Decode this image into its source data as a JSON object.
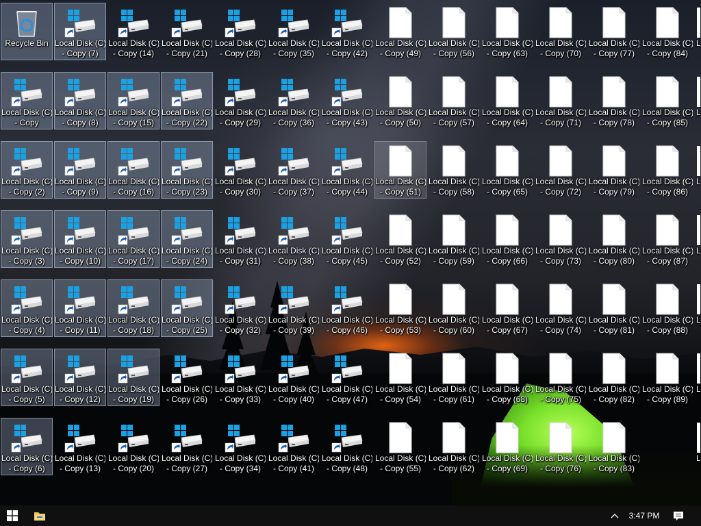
{
  "desktop": {
    "recycle_bin_label": "Recycle Bin",
    "icons": [
      {
        "l1": "Local Disk (C)",
        "l2": "- Copy",
        "type": "disk",
        "state": "sel"
      },
      {
        "l1": "Local Disk (C)",
        "l2": "- Copy (2)",
        "type": "disk",
        "state": "sel"
      },
      {
        "l1": "Local Disk (C)",
        "l2": "- Copy (3)",
        "type": "disk",
        "state": "sel"
      },
      {
        "l1": "Local Disk (C)",
        "l2": "- Copy (4)",
        "type": "disk",
        "state": "sel"
      },
      {
        "l1": "Local Disk (C)",
        "l2": "- Copy (5)",
        "type": "disk",
        "state": "sel"
      },
      {
        "l1": "Local Disk (C)",
        "l2": "- Copy (6)",
        "type": "disk",
        "state": "sel"
      },
      {
        "l1": "Local Disk (C)",
        "l2": "- Copy (7)",
        "type": "disk",
        "state": "sel"
      },
      {
        "l1": "Local Disk (C)",
        "l2": "- Copy (8)",
        "type": "disk",
        "state": "sel"
      },
      {
        "l1": "Local Disk (C)",
        "l2": "- Copy (9)",
        "type": "disk",
        "state": "sel"
      },
      {
        "l1": "Local Disk (C)",
        "l2": "- Copy (10)",
        "type": "disk",
        "state": "sel"
      },
      {
        "l1": "Local Disk (C)",
        "l2": "- Copy (11)",
        "type": "disk",
        "state": "sel"
      },
      {
        "l1": "Local Disk (C)",
        "l2": "- Copy (12)",
        "type": "disk",
        "state": "sel"
      },
      {
        "l1": "Local Disk (C)",
        "l2": "- Copy (13)",
        "type": "disk",
        "state": ""
      },
      {
        "l1": "Local Disk (C)",
        "l2": "- Copy (14)",
        "type": "disk",
        "state": ""
      },
      {
        "l1": "Local Disk (C)",
        "l2": "- Copy (15)",
        "type": "disk",
        "state": "sel"
      },
      {
        "l1": "Local Disk (C)",
        "l2": "- Copy (16)",
        "type": "disk",
        "state": "sel"
      },
      {
        "l1": "Local Disk (C)",
        "l2": "- Copy (17)",
        "type": "disk",
        "state": "sel"
      },
      {
        "l1": "Local Disk (C)",
        "l2": "- Copy (18)",
        "type": "disk",
        "state": "sel"
      },
      {
        "l1": "Local Disk (C)",
        "l2": "- Copy (19)",
        "type": "disk",
        "state": "sel"
      },
      {
        "l1": "Local Disk (C)",
        "l2": "- Copy (20)",
        "type": "disk",
        "state": ""
      },
      {
        "l1": "Local Disk (C)",
        "l2": "- Copy (21)",
        "type": "disk",
        "state": ""
      },
      {
        "l1": "Local Disk (C)",
        "l2": "- Copy (22)",
        "type": "disk",
        "state": "sel"
      },
      {
        "l1": "Local Disk (C)",
        "l2": "- Copy (23)",
        "type": "disk",
        "state": "sel"
      },
      {
        "l1": "Local Disk (C)",
        "l2": "- Copy (24)",
        "type": "disk",
        "state": "sel"
      },
      {
        "l1": "Local Disk (C)",
        "l2": "- Copy (25)",
        "type": "disk",
        "state": "sel"
      },
      {
        "l1": "Local Disk (C)",
        "l2": "- Copy (26)",
        "type": "disk",
        "state": ""
      },
      {
        "l1": "Local Disk (C)",
        "l2": "- Copy (27)",
        "type": "disk",
        "state": ""
      },
      {
        "l1": "Local Disk (C)",
        "l2": "- Copy (28)",
        "type": "disk",
        "state": ""
      },
      {
        "l1": "Local Disk (C)",
        "l2": "- Copy (29)",
        "type": "disk",
        "state": ""
      },
      {
        "l1": "Local Disk (C)",
        "l2": "- Copy (30)",
        "type": "disk",
        "state": ""
      },
      {
        "l1": "Local Disk (C)",
        "l2": "- Copy (31)",
        "type": "disk",
        "state": ""
      },
      {
        "l1": "Local Disk (C)",
        "l2": "- Copy (32)",
        "type": "disk",
        "state": ""
      },
      {
        "l1": "Local Disk (C)",
        "l2": "- Copy (33)",
        "type": "disk",
        "state": ""
      },
      {
        "l1": "Local Disk (C)",
        "l2": "- Copy (34)",
        "type": "disk",
        "state": ""
      },
      {
        "l1": "Local Disk (C)",
        "l2": "- Copy (35)",
        "type": "disk",
        "state": ""
      },
      {
        "l1": "Local Disk (C)",
        "l2": "- Copy (36)",
        "type": "disk",
        "state": ""
      },
      {
        "l1": "Local Disk (C)",
        "l2": "- Copy (37)",
        "type": "disk",
        "state": ""
      },
      {
        "l1": "Local Disk (C)",
        "l2": "- Copy (38)",
        "type": "disk",
        "state": ""
      },
      {
        "l1": "Local Disk (C)",
        "l2": "- Copy (39)",
        "type": "disk",
        "state": ""
      },
      {
        "l1": "Local Disk (C)",
        "l2": "- Copy (40)",
        "type": "disk",
        "state": ""
      },
      {
        "l1": "Local Disk (C)",
        "l2": "- Copy (41)",
        "type": "disk",
        "state": ""
      },
      {
        "l1": "Local Disk (C)",
        "l2": "- Copy (42)",
        "type": "disk",
        "state": ""
      },
      {
        "l1": "Local Disk (C)",
        "l2": "- Copy (43)",
        "type": "disk",
        "state": ""
      },
      {
        "l1": "Local Disk (C)",
        "l2": "- Copy (44)",
        "type": "disk",
        "state": ""
      },
      {
        "l1": "Local Disk (C)",
        "l2": "- Copy (45)",
        "type": "disk",
        "state": ""
      },
      {
        "l1": "Local Disk (C)",
        "l2": "- Copy (46)",
        "type": "disk",
        "state": ""
      },
      {
        "l1": "Local Disk (C)",
        "l2": "- Copy (47)",
        "type": "disk",
        "state": ""
      },
      {
        "l1": "Local Disk (C)",
        "l2": "- Copy (48)",
        "type": "disk",
        "state": ""
      },
      {
        "l1": "Local Disk (C)",
        "l2": "- Copy (49)",
        "type": "file",
        "state": ""
      },
      {
        "l1": "Local Disk (C)",
        "l2": "- Copy (50)",
        "type": "file",
        "state": ""
      },
      {
        "l1": "Local Disk (C)",
        "l2": "- Copy (51)",
        "type": "file",
        "state": "hov"
      },
      {
        "l1": "Local Disk (C)",
        "l2": "- Copy (52)",
        "type": "file",
        "state": ""
      },
      {
        "l1": "Local Disk (C)",
        "l2": "- Copy (53)",
        "type": "file",
        "state": ""
      },
      {
        "l1": "Local Disk (C)",
        "l2": "- Copy (54)",
        "type": "file",
        "state": ""
      },
      {
        "l1": "Local Disk (C)",
        "l2": "- Copy (55)",
        "type": "file",
        "state": ""
      },
      {
        "l1": "Local Disk (C)",
        "l2": "- Copy (56)",
        "type": "file",
        "state": ""
      },
      {
        "l1": "Local Disk (C)",
        "l2": "- Copy (57)",
        "type": "file",
        "state": ""
      },
      {
        "l1": "Local Disk (C)",
        "l2": "- Copy (58)",
        "type": "file",
        "state": ""
      },
      {
        "l1": "Local Disk (C)",
        "l2": "- Copy (59)",
        "type": "file",
        "state": ""
      },
      {
        "l1": "Local Disk (C)",
        "l2": "- Copy (60)",
        "type": "file",
        "state": ""
      },
      {
        "l1": "Local Disk (C)",
        "l2": "- Copy (61)",
        "type": "file",
        "state": ""
      },
      {
        "l1": "Local Disk (C)",
        "l2": "- Copy (62)",
        "type": "file",
        "state": ""
      },
      {
        "l1": "Local Disk (C)",
        "l2": "- Copy (63)",
        "type": "file",
        "state": ""
      },
      {
        "l1": "Local Disk (C)",
        "l2": "- Copy (64)",
        "type": "file",
        "state": ""
      },
      {
        "l1": "Local Disk (C)",
        "l2": "- Copy (65)",
        "type": "file",
        "state": ""
      },
      {
        "l1": "Local Disk (C)",
        "l2": "- Copy (66)",
        "type": "file",
        "state": ""
      },
      {
        "l1": "Local Disk (C)",
        "l2": "- Copy (67)",
        "type": "file",
        "state": ""
      },
      {
        "l1": "Local Disk (C)",
        "l2": "- Copy (68)",
        "type": "file",
        "state": ""
      },
      {
        "l1": "Local Disk (C)",
        "l2": "- Copy (69)",
        "type": "file",
        "state": ""
      },
      {
        "l1": "Local Disk (C)",
        "l2": "- Copy (70)",
        "type": "file",
        "state": ""
      },
      {
        "l1": "Local Disk (C)",
        "l2": "- Copy (71)",
        "type": "file",
        "state": ""
      },
      {
        "l1": "Local Disk (C)",
        "l2": "- Copy (72)",
        "type": "file",
        "state": ""
      },
      {
        "l1": "Local Disk (C)",
        "l2": "- Copy (73)",
        "type": "file",
        "state": ""
      },
      {
        "l1": "Local Disk (C)",
        "l2": "- Copy (74)",
        "type": "file",
        "state": ""
      },
      {
        "l1": "Local Disk (C)",
        "l2": "- Copy (75)",
        "type": "file",
        "state": ""
      },
      {
        "l1": "Local Disk (C)",
        "l2": "- Copy (76)",
        "type": "file",
        "state": ""
      },
      {
        "l1": "Local Disk (C)",
        "l2": "- Copy (77)",
        "type": "file",
        "state": ""
      },
      {
        "l1": "Local Disk (C)",
        "l2": "- Copy (78)",
        "type": "file",
        "state": ""
      },
      {
        "l1": "Local Disk (C)",
        "l2": "- Copy (79)",
        "type": "file",
        "state": ""
      },
      {
        "l1": "Local Disk (C)",
        "l2": "- Copy (80)",
        "type": "file",
        "state": ""
      },
      {
        "l1": "Local Disk (C)",
        "l2": "- Copy (81)",
        "type": "file",
        "state": ""
      },
      {
        "l1": "Local Disk (C)",
        "l2": "- Copy (82)",
        "type": "file",
        "state": ""
      },
      {
        "l1": "Local Disk (C)",
        "l2": "- Copy (83)",
        "type": "file",
        "state": ""
      },
      {
        "l1": "Local Disk (C)",
        "l2": "- Copy (84)",
        "type": "file",
        "state": ""
      },
      {
        "l1": "Local Disk (C)",
        "l2": "- Copy (85)",
        "type": "file",
        "state": ""
      },
      {
        "l1": "Local Disk (C)",
        "l2": "- Copy (86)",
        "type": "file",
        "state": ""
      },
      {
        "l1": "Local Disk (C)",
        "l2": "- Copy (87)",
        "type": "file",
        "state": ""
      },
      {
        "l1": "Local Disk (C)",
        "l2": "- Copy (88)",
        "type": "file",
        "state": ""
      },
      {
        "l1": "Local Disk (C)",
        "l2": "- Copy (89)",
        "type": "file",
        "state": ""
      }
    ],
    "partial_column_labels": [
      "L",
      "L",
      "L",
      "L",
      "L",
      "L",
      "L"
    ]
  },
  "taskbar": {
    "start_icon": "windows-logo-icon",
    "pinned": [
      {
        "name": "file-explorer-icon"
      }
    ],
    "tray_chevron_icon": "chevron-up-icon",
    "clock": "3:47 PM",
    "notification_icon": "action-center-icon"
  },
  "colors": {
    "selection_bg": "#a0b4d2",
    "taskbar_bg": "#101010",
    "windows_blue": "#1ba1e2",
    "shortcut_arrow_blue": "#1a5fb4"
  }
}
